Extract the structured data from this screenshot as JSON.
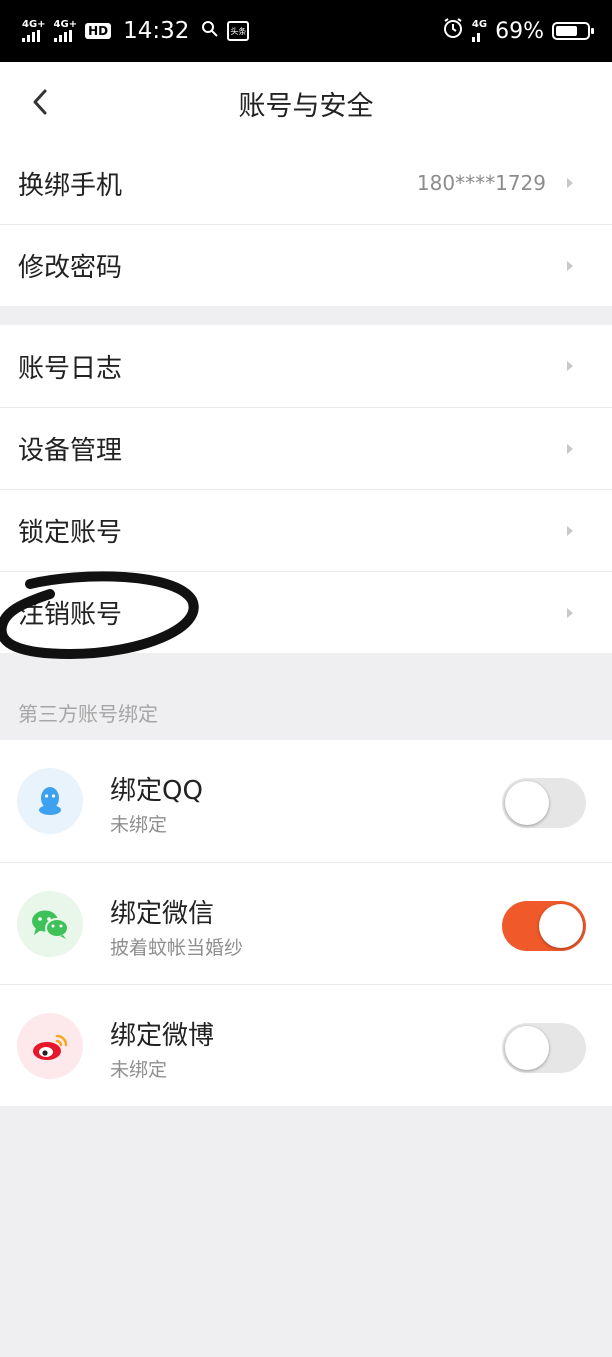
{
  "status_bar": {
    "network_1": "4G+",
    "network_2": "4G+",
    "hd_label": "HD",
    "time": "14:32",
    "mini_app_label": "头条",
    "network_3": "4G",
    "battery_percent": "69%",
    "battery_level": 0.69
  },
  "header": {
    "title": "账号与安全",
    "back_icon": "chevron-left-icon"
  },
  "group1": [
    {
      "label": "换绑手机",
      "value": "180****1729"
    },
    {
      "label": "修改密码",
      "value": ""
    }
  ],
  "group2": [
    {
      "label": "账号日志"
    },
    {
      "label": "设备管理"
    },
    {
      "label": "锁定账号"
    },
    {
      "label": "注销账号"
    }
  ],
  "third_party": {
    "section_title": "第三方账号绑定",
    "items": [
      {
        "title": "绑定QQ",
        "subtitle": "未绑定",
        "enabled": false,
        "icon": "qq-icon",
        "icon_color": "#3ca2f0",
        "icon_bg": "#e9f3fc"
      },
      {
        "title": "绑定微信",
        "subtitle": "披着蚊帐当婚纱",
        "enabled": true,
        "icon": "wechat-icon",
        "icon_color": "#3fc15a",
        "icon_bg": "#e8f7ea"
      },
      {
        "title": "绑定微博",
        "subtitle": "未绑定",
        "enabled": false,
        "icon": "weibo-icon",
        "icon_color": "#e6162d",
        "icon_bg": "#fde9ec"
      }
    ]
  },
  "colors": {
    "toggle_on": "#f05a2a",
    "toggle_off": "#e6e6e6",
    "background": "#efeff2"
  }
}
